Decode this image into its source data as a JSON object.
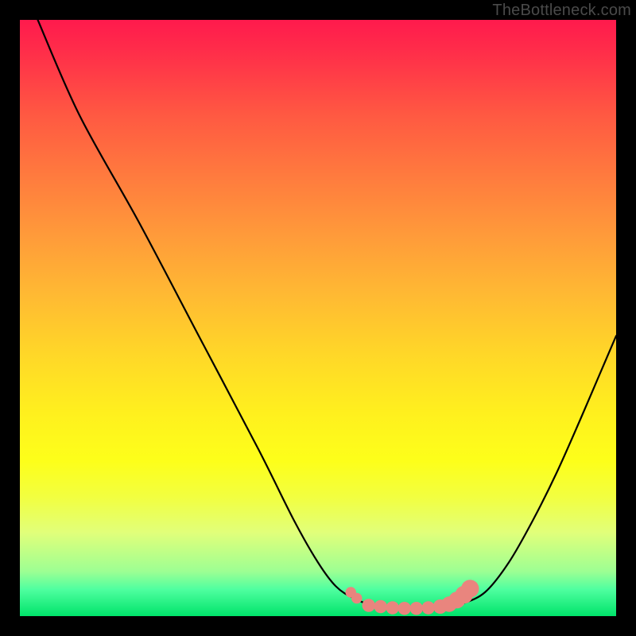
{
  "watermark": "TheBottleneck.com",
  "chart_data": {
    "type": "line",
    "title": "",
    "xlabel": "",
    "ylabel": "",
    "xlim": [
      0,
      100
    ],
    "ylim": [
      0,
      100
    ],
    "series": [
      {
        "name": "curve",
        "color": "#000000",
        "x": [
          3,
          10,
          20,
          30,
          40,
          46,
          50,
          53,
          56,
          60,
          64,
          68,
          71,
          74,
          78,
          82,
          86,
          90,
          94,
          97,
          100
        ],
        "y": [
          100,
          84,
          66,
          47,
          28,
          16,
          9,
          5,
          3,
          1.5,
          1,
          1,
          1.2,
          2,
          4,
          9,
          16,
          24,
          33,
          40,
          47
        ]
      }
    ],
    "markers": {
      "name": "highlight-band",
      "color": "#e9857e",
      "points": [
        {
          "x": 55.5,
          "y": 4.0,
          "r": 0.9
        },
        {
          "x": 56.5,
          "y": 3.0,
          "r": 0.9
        },
        {
          "x": 58.5,
          "y": 1.8,
          "r": 1.1
        },
        {
          "x": 60.5,
          "y": 1.6,
          "r": 1.1
        },
        {
          "x": 62.5,
          "y": 1.4,
          "r": 1.1
        },
        {
          "x": 64.5,
          "y": 1.3,
          "r": 1.1
        },
        {
          "x": 66.5,
          "y": 1.3,
          "r": 1.1
        },
        {
          "x": 68.5,
          "y": 1.4,
          "r": 1.1
        },
        {
          "x": 70.5,
          "y": 1.6,
          "r": 1.2
        },
        {
          "x": 72.0,
          "y": 2.0,
          "r": 1.3
        },
        {
          "x": 73.3,
          "y": 2.7,
          "r": 1.4
        },
        {
          "x": 74.5,
          "y": 3.6,
          "r": 1.5
        },
        {
          "x": 75.5,
          "y": 4.6,
          "r": 1.5
        }
      ]
    },
    "gradient_colors": {
      "top": "#ff1a4d",
      "mid_upper": "#ff9a3a",
      "mid": "#fff01e",
      "lower": "#9dff93",
      "bottom": "#00e36a"
    }
  }
}
